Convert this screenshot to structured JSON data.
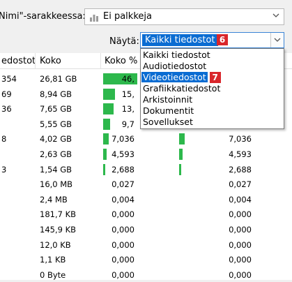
{
  "toolbar": {
    "bars_label": "Nimi\"-sarakkeessa:",
    "bars_value": "Ei palkkeja",
    "show_label": "Näytä:",
    "show_value": "Kaikki tiedostot",
    "show_badge": "6"
  },
  "dropdown": {
    "options": [
      "Kaikki tiedostot",
      "Audiotiedostot",
      "Videotiedostot",
      "Grafiikkatiedostot",
      "Arkistoinnit",
      "Dokumentit",
      "Sovellukset"
    ],
    "highlighted_badge": "7"
  },
  "table": {
    "headers": [
      "edostot",
      "Koko",
      "Koko %"
    ],
    "rows": [
      {
        "files": "354",
        "size": "26,81 GB",
        "pct": "46,",
        "bar1": 0.95,
        "bar2": 0,
        "pct2": ""
      },
      {
        "files": "69",
        "size": "8,94 GB",
        "pct": "15,",
        "bar1": 0.32,
        "bar2": 0,
        "pct2": ""
      },
      {
        "files": "36",
        "size": "7,65 GB",
        "pct": "13,",
        "bar1": 0.28,
        "bar2": 0,
        "pct2": ""
      },
      {
        "files": "",
        "size": "5,55 GB",
        "pct": "9,7",
        "bar1": 0.2,
        "bar2": 0,
        "pct2": ""
      },
      {
        "files": "8",
        "size": "4,02 GB",
        "pct": "7,036",
        "bar1": 0.15,
        "bar2": 0.15,
        "pct2": "7,036"
      },
      {
        "files": "",
        "size": "2,63 GB",
        "pct": "4,593",
        "bar1": 0.1,
        "bar2": 0.1,
        "pct2": "4,593"
      },
      {
        "files": "3",
        "size": "1,54 GB",
        "pct": "2,688",
        "bar1": 0.05,
        "bar2": 0.05,
        "pct2": "2,688"
      },
      {
        "files": "",
        "size": "16,0 MB",
        "pct": "0,027",
        "bar1": 0,
        "bar2": 0,
        "pct2": "0,027"
      },
      {
        "files": "",
        "size": "2,4 MB",
        "pct": "0,004",
        "bar1": 0,
        "bar2": 0,
        "pct2": "0,004"
      },
      {
        "files": "",
        "size": "181,7 KB",
        "pct": "0,000",
        "bar1": 0,
        "bar2": 0,
        "pct2": "0,000"
      },
      {
        "files": "",
        "size": "145,9 KB",
        "pct": "0,000",
        "bar1": 0,
        "bar2": 0,
        "pct2": "0,000"
      },
      {
        "files": "",
        "size": "12,0 KB",
        "pct": "0,000",
        "bar1": 0,
        "bar2": 0,
        "pct2": "0,000"
      },
      {
        "files": "",
        "size": "1,1 KB",
        "pct": "0,000",
        "bar1": 0,
        "bar2": 0,
        "pct2": "0,000"
      },
      {
        "files": "",
        "size": "0 Byte",
        "pct": "0,000",
        "bar1": 0,
        "bar2": 0,
        "pct2": "0,000"
      }
    ]
  },
  "colors": {
    "accent": "#0a6cd2",
    "bar": "#2db84c",
    "badge": "#d9262b"
  }
}
